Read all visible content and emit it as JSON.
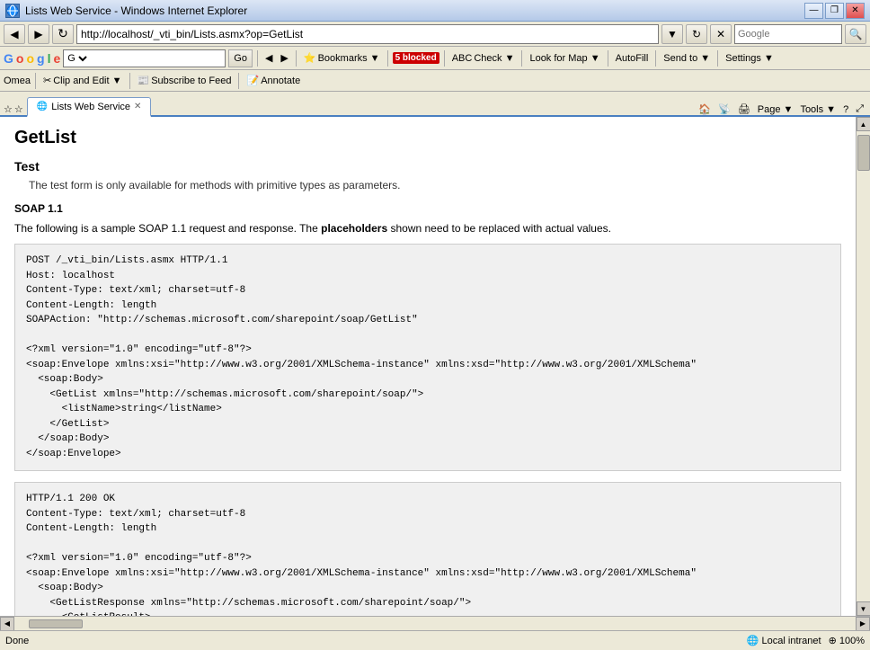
{
  "titleBar": {
    "title": "Lists Web Service - Windows Internet Explorer",
    "minBtn": "—",
    "maxBtn": "❐",
    "closeBtn": "✕"
  },
  "navBar": {
    "backBtn": "◀",
    "forwardBtn": "▶",
    "address": "http://localhost/_vti_bin/Lists.asmx?op=GetList",
    "refreshBtn": "↻",
    "stopBtn": "✕",
    "searchPlaceholder": "Google"
  },
  "googleBar": {
    "logo": "Google",
    "searchDropdown": "G▼",
    "goBtn": "Go",
    "bookmarksBtn": "Bookmarks ▼",
    "blockedCount": "5 blocked",
    "checkBtn": "Check ▼",
    "lookForMapBtn": "Look for Map ▼",
    "autoFillBtn": "AutoFill",
    "sendToBtn": "Send to ▼",
    "settingsBtn": "Settings ▼"
  },
  "omeaBar": {
    "omeaLabel": "Omea",
    "clipEditBtn": "Clip and Edit ▼",
    "subscribeBtn": "Subscribe to Feed",
    "annotateBtn": "Annotate"
  },
  "tabs": [
    {
      "label": "Lists Web Service",
      "active": true
    }
  ],
  "secondToolbar": {
    "favBtn": "☆",
    "feedBtn": "✦",
    "pageBtn": "Page ▼",
    "toolsBtn": "Tools ▼",
    "helpBtn": "?",
    "resizeBtn": "⤢"
  },
  "content": {
    "pageTitle": "GetList",
    "testSection": {
      "title": "Test",
      "description": "The test form is only available for methods with primitive types as parameters."
    },
    "soapSection": {
      "title": "SOAP 1.1",
      "intro": "The following is a sample SOAP 1.1 request and response. The",
      "boldWord": "placeholders",
      "introEnd": "shown need to be replaced with actual values.",
      "requestBlock": "POST /_vti_bin/Lists.asmx HTTP/1.1\nHost: localhost\nContent-Type: text/xml; charset=utf-8\nContent-Length: length\nSOAPAction: \"http://schemas.microsoft.com/sharepoint/soap/GetList\"\n\n<?xml version=\"1.0\" encoding=\"utf-8\"?>\n<soap:Envelope xmlns:xsi=\"http://www.w3.org/2001/XMLSchema-instance\" xmlns:xsd=\"http://www.w3.org/2001/XMLSchema\"\n  <soap:Body>\n    <GetList xmlns=\"http://schemas.microsoft.com/sharepoint/soap/\">\n      <listName>string</listName>\n    </GetList>\n  </soap:Body>\n</soap:Envelope>",
      "responseBlock": "HTTP/1.1 200 OK\nContent-Type: text/xml; charset=utf-8\nContent-Length: length\n\n<?xml version=\"1.0\" encoding=\"utf-8\"?>\n<soap:Envelope xmlns:xsi=\"http://www.w3.org/2001/XMLSchema-instance\" xmlns:xsd=\"http://www.w3.org/2001/XMLSchema\n  <soap:Body>\n    <GetListResponse xmlns=\"http://schemas.microsoft.com/sharepoint/soap/\">\n      <GetListResult>\n        <xsd:schema</xsd:schema>xml</GetListResult>"
    }
  },
  "statusBar": {
    "status": "Done",
    "zone": "Local intranet",
    "zoom": "100%"
  }
}
